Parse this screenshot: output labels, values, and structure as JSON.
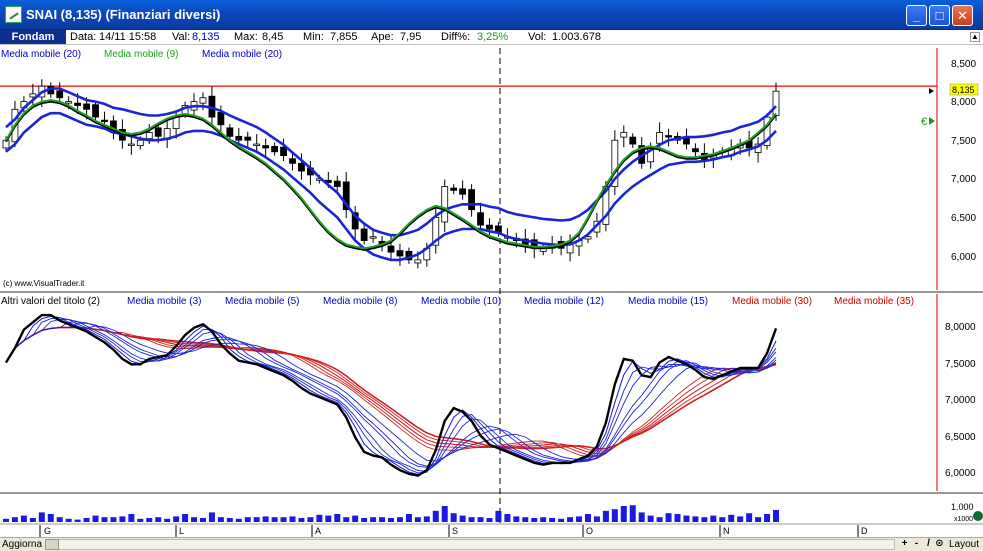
{
  "window": {
    "title": "SNAI (8,135)  (Finanziari diversi)",
    "buttons": {
      "minimize": "_",
      "maximize": "□",
      "close": "✕"
    }
  },
  "infobar": {
    "fondam_label": "Fondam",
    "data_label": "Data:",
    "data_value": "14/11 15:58",
    "val_label": "Val:",
    "val_value": "8,135",
    "max_label": "Max:",
    "max_value": "8,45",
    "min_label": "Min:",
    "min_value": "7,855",
    "ape_label": "Ape:",
    "ape_value": "7,95",
    "diff_label": "Diff%:",
    "diff_value": "3,25%",
    "vol_label": "Vol:",
    "vol_value": "1.003.678"
  },
  "panel_top": {
    "legends": [
      {
        "label": "Media mobile (20)",
        "color": "#0000cc"
      },
      {
        "label": "Media mobile (9)",
        "color": "#22a022"
      },
      {
        "label": "Media mobile (20)",
        "color": "#0000cc"
      }
    ],
    "copyright": "(c) www.VisualTrader.it",
    "price_tag": "8,135",
    "euro_marker": "€",
    "y_ticks": [
      "8,500",
      "8,000",
      "7,500",
      "7,000",
      "6,500",
      "6,000"
    ]
  },
  "panel_mid": {
    "legends": [
      {
        "label": "Altri valori del titolo (2)",
        "color": "#000000"
      },
      {
        "label": "Media mobile (3)",
        "color": "#0000cc"
      },
      {
        "label": "Media mobile (5)",
        "color": "#0000cc"
      },
      {
        "label": "Media mobile (8)",
        "color": "#0000cc"
      },
      {
        "label": "Media mobile (10)",
        "color": "#0000cc"
      },
      {
        "label": "Media mobile (12)",
        "color": "#0000cc"
      },
      {
        "label": "Media mobile (15)",
        "color": "#0000cc"
      },
      {
        "label": "Media mobile (30)",
        "color": "#cc0000"
      },
      {
        "label": "Media mobile (35)",
        "color": "#cc0000"
      }
    ],
    "y_ticks": [
      "8,0000",
      "7,5000",
      "7,0000",
      "6,5000",
      "6,0000"
    ]
  },
  "panel_vol": {
    "y_tick": "1.000",
    "y_unit": "x1000"
  },
  "time_axis": {
    "months": [
      "G",
      "L",
      "A",
      "S",
      "O",
      "N",
      "D"
    ]
  },
  "statusbar": {
    "aggiorna": "Aggiorna",
    "layout_label": "Layout",
    "tools": [
      "+",
      "-",
      "/",
      "⊙"
    ]
  },
  "chart_data": [
    {
      "type": "candlestick",
      "title": "SNAI (8,135)",
      "ylim": [
        5.7,
        8.6
      ],
      "last": 8.135,
      "reference_line": 8.2,
      "close": [
        7.5,
        7.9,
        8.0,
        8.1,
        8.2,
        8.1,
        8.05,
        8.0,
        7.95,
        7.9,
        7.8,
        7.75,
        7.6,
        7.5,
        7.45,
        7.5,
        7.6,
        7.55,
        7.65,
        7.8,
        7.95,
        8.0,
        8.05,
        7.8,
        7.7,
        7.55,
        7.5,
        7.5,
        7.45,
        7.4,
        7.35,
        7.3,
        7.2,
        7.1,
        7.05,
        7.0,
        6.95,
        6.9,
        6.6,
        6.35,
        6.2,
        6.25,
        6.15,
        6.05,
        6.0,
        5.95,
        5.95,
        6.1,
        6.5,
        6.9,
        6.85,
        6.8,
        6.6,
        6.4,
        6.35,
        6.3,
        6.25,
        6.2,
        6.15,
        6.1,
        6.1,
        6.15,
        6.1,
        6.15,
        6.2,
        6.25,
        6.45,
        6.9,
        7.5,
        7.6,
        7.45,
        7.2,
        7.4,
        7.6,
        7.55,
        7.5,
        7.45,
        7.35,
        7.25,
        7.3,
        7.35,
        7.4,
        7.45,
        7.4,
        7.45,
        7.8,
        8.135
      ],
      "ma_series": [
        {
          "name": "Media mobile (20)",
          "values": [
            7.45,
            7.55,
            7.7,
            7.8,
            7.9,
            7.95,
            7.95,
            7.9,
            7.85,
            7.8,
            7.78,
            7.75,
            7.7,
            7.68,
            7.65,
            7.62,
            7.6,
            7.6,
            7.62,
            7.65,
            7.7,
            7.72,
            7.72,
            7.7,
            7.66,
            7.6,
            7.55,
            7.5,
            7.45,
            7.38,
            7.3,
            7.22,
            7.12,
            7.02,
            6.92,
            6.8,
            6.7,
            6.6,
            6.45,
            6.3,
            6.2,
            6.12,
            6.08,
            6.05,
            6.05,
            6.08,
            6.12,
            6.2,
            6.3,
            6.38,
            6.42,
            6.45,
            6.45,
            6.45,
            6.42,
            6.4,
            6.35,
            6.32,
            6.3,
            6.28,
            6.26,
            6.25,
            6.24,
            6.25,
            6.3,
            6.38,
            6.5,
            6.62,
            6.78,
            6.9,
            7.0,
            7.08,
            7.15,
            7.22,
            7.28,
            7.3,
            7.32,
            7.32,
            7.33,
            7.35,
            7.38,
            7.4,
            7.45,
            7.48,
            7.52,
            7.6,
            7.72
          ]
        },
        {
          "name": "Media mobile (9)",
          "values": [
            7.5,
            7.7,
            7.85,
            7.95,
            8.0,
            8.02,
            8.0,
            7.95,
            7.88,
            7.82,
            7.75,
            7.7,
            7.65,
            7.6,
            7.58,
            7.6,
            7.65,
            7.72,
            7.78,
            7.82,
            7.84,
            7.82,
            7.78,
            7.7,
            7.6,
            7.5,
            7.42,
            7.35,
            7.28,
            7.2,
            7.1,
            7.0,
            6.88,
            6.75,
            6.6,
            6.45,
            6.32,
            6.22,
            6.15,
            6.12,
            6.1,
            6.12,
            6.15,
            6.2,
            6.3,
            6.42,
            6.52,
            6.6,
            6.65,
            6.62,
            6.55,
            6.48,
            6.4,
            6.32,
            6.26,
            6.22,
            6.18,
            6.16,
            6.14,
            6.12,
            6.12,
            6.13,
            6.15,
            6.2,
            6.3,
            6.5,
            6.72,
            6.92,
            7.1,
            7.25,
            7.35,
            7.4,
            7.42,
            7.4,
            7.35,
            7.3,
            7.28,
            7.28,
            7.3,
            7.32,
            7.36,
            7.4,
            7.45,
            7.5,
            7.6,
            7.7,
            7.85
          ]
        }
      ]
    },
    {
      "type": "line",
      "title": "Altri valori del titolo (2)",
      "ylim": [
        5.8,
        8.2
      ]
    },
    {
      "type": "bar",
      "title": "Volume",
      "values": [
        0.2,
        0.3,
        0.4,
        0.25,
        0.6,
        0.5,
        0.3,
        0.2,
        0.15,
        0.25,
        0.4,
        0.3,
        0.3,
        0.35,
        0.5,
        0.2,
        0.25,
        0.3,
        0.2,
        0.35,
        0.5,
        0.3,
        0.25,
        0.6,
        0.3,
        0.25,
        0.2,
        0.3,
        0.3,
        0.35,
        0.3,
        0.3,
        0.35,
        0.25,
        0.3,
        0.45,
        0.4,
        0.5,
        0.3,
        0.4,
        0.25,
        0.3,
        0.3,
        0.25,
        0.3,
        0.5,
        0.3,
        0.35,
        0.7,
        1.0,
        0.55,
        0.4,
        0.3,
        0.3,
        0.25,
        0.7,
        0.5,
        0.35,
        0.3,
        0.25,
        0.3,
        0.25,
        0.2,
        0.3,
        0.35,
        0.5,
        0.35,
        0.7,
        0.8,
        1.0,
        1.05,
        0.6,
        0.4,
        0.3,
        0.55,
        0.5,
        0.4,
        0.35,
        0.3,
        0.4,
        0.3,
        0.45,
        0.35,
        0.55,
        0.3,
        0.5,
        0.75
      ]
    }
  ]
}
